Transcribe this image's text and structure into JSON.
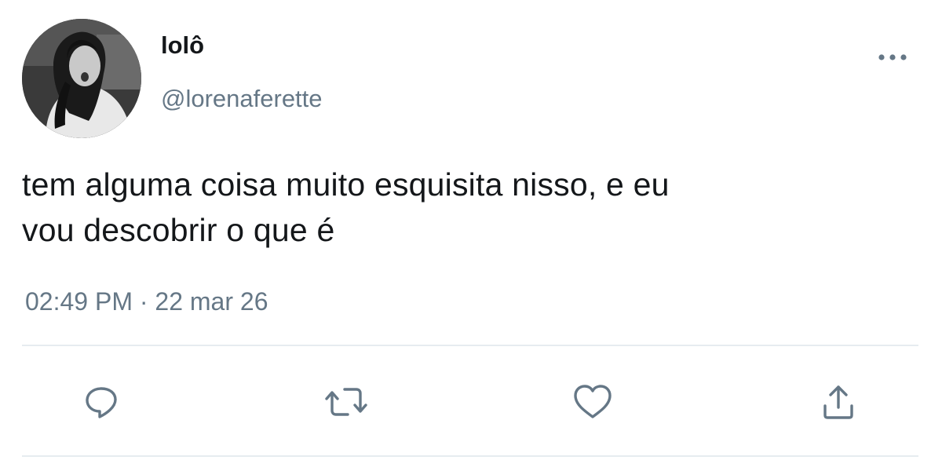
{
  "author": {
    "display_name": "lolô",
    "handle": "@lorenaferette"
  },
  "tweet": {
    "text_line1": "tem alguma coisa muito esquisita nisso, e eu",
    "text_line2": "vou descobrir o que é",
    "time": "02:49 PM",
    "separator": "·",
    "date": "22 mar 26"
  },
  "icons": {
    "more": "more-dots-icon",
    "reply": "reply-icon",
    "retweet": "retweet-icon",
    "like": "heart-icon",
    "share": "share-icon"
  },
  "colors": {
    "text": "#14171a",
    "secondary": "#657786",
    "divider": "#e6ecf0"
  }
}
